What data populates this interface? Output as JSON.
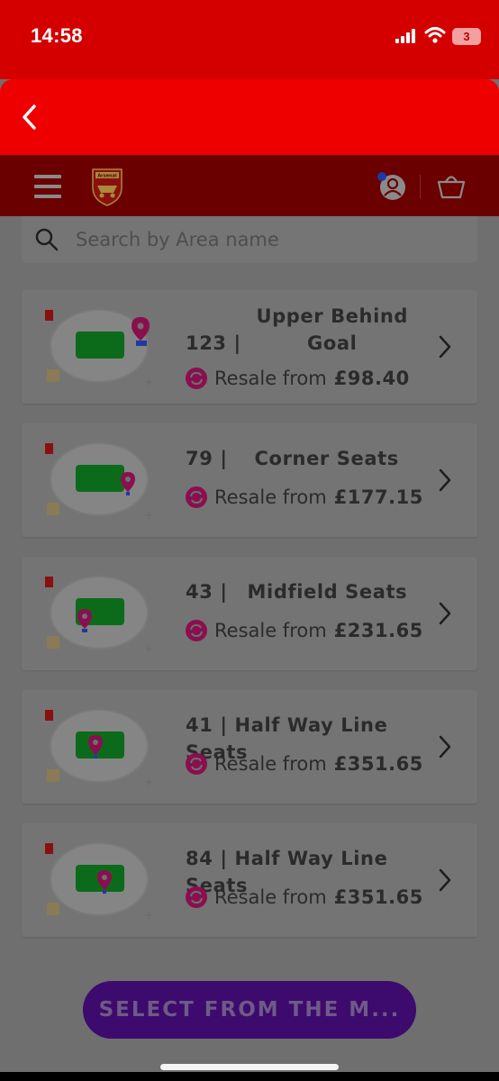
{
  "status_bar": {
    "time": "14:58",
    "battery": "3",
    "icons": [
      "signal-icon",
      "wifi-icon",
      "battery-icon"
    ]
  },
  "header": {
    "back_icon": "chevron-left-icon"
  },
  "site_nav": {
    "logo_text": "Arsenal",
    "icons": [
      "menu-icon",
      "account-icon",
      "basket-icon"
    ]
  },
  "search": {
    "placeholder": "Search by Area name",
    "value": ""
  },
  "areas": [
    {
      "number": "123 |",
      "name": "Upper Behind Goal",
      "price_label": "Resale from",
      "price": "£98.40"
    },
    {
      "number": "79 |",
      "name": "Corner Seats",
      "price_label": "Resale from",
      "price": "£177.15"
    },
    {
      "number": "43 |",
      "name": "Midfield Seats",
      "price_label": "Resale from",
      "price": "£231.65"
    },
    {
      "number": "41 |",
      "name": "Half Way Line Seats",
      "price_label": "Resale from",
      "price": "£351.65"
    },
    {
      "number": "84 |",
      "name": "Half Way Line Seats",
      "price_label": "Resale from",
      "price": "£351.65"
    }
  ],
  "select_button": {
    "label": "SELECT FROM THE M..."
  },
  "colors": {
    "brand_red": "#ee0000",
    "nav_dark_red": "#6a0000",
    "pitch_green": "#0c6b1a",
    "pin_magenta": "#8a0f4e",
    "button_purple": "#3d0a6e"
  }
}
